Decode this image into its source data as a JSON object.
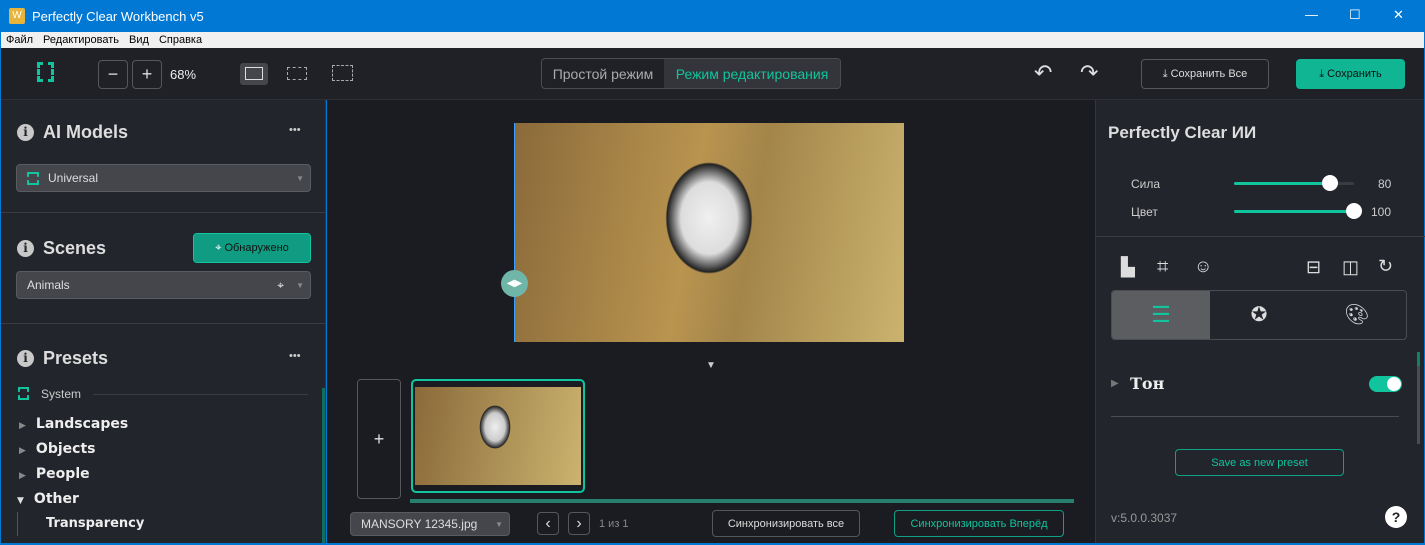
{
  "window": {
    "title": "Perfectly Clear Workbench v5",
    "controls": [
      "—",
      "☐",
      "✕"
    ]
  },
  "menu": [
    "Файл",
    "Редактировать",
    "Вид",
    "Справка"
  ],
  "toolbar": {
    "zoom_minus": "−",
    "zoom_plus": "+",
    "zoom": "68%",
    "mode_simple": "Простой режим",
    "mode_edit": "Режим редактирования",
    "undo": "↶",
    "redo": "↷",
    "save_all": "Сохранить Все",
    "save": "Сохранить"
  },
  "left": {
    "ai_models": {
      "title": "AI Models",
      "more": "•••",
      "model": "Universal"
    },
    "scenes": {
      "title": "Scenes",
      "detected": "Обнаружено",
      "scene": "Animals"
    },
    "presets": {
      "title": "Presets",
      "more": "•••",
      "group": "System",
      "items": [
        {
          "label": "Landscapes",
          "expanded": false
        },
        {
          "label": "Objects",
          "expanded": false
        },
        {
          "label": "People",
          "expanded": false
        },
        {
          "label": "Other",
          "expanded": true
        }
      ],
      "child": "Transparency"
    }
  },
  "center": {
    "add": "+",
    "file": "MANSORY 12345.jpg",
    "prev": "‹",
    "next": "›",
    "page": "1 из 1",
    "sync_all": "Синхронизировать все",
    "sync_forward": "Синхронизировать Вперёд"
  },
  "right": {
    "title": "Perfectly Clear ИИ",
    "sliders": [
      {
        "label": "Сила",
        "value": 80
      },
      {
        "label": "Цвет",
        "value": 100
      }
    ],
    "section": "Тон",
    "section_enabled": true,
    "save_preset": "Save as new preset",
    "version": "v:5.0.0.3037",
    "help": "?"
  },
  "colors": {
    "accent": "#10c49e",
    "titlebar": "#0078d4"
  }
}
